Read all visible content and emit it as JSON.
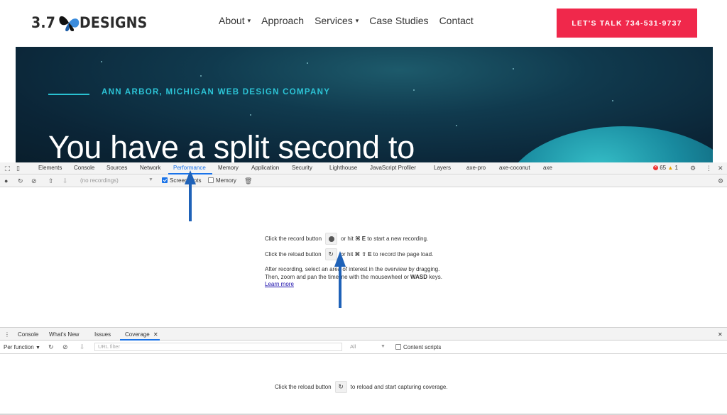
{
  "site": {
    "logo_left": "3.7",
    "logo_right": "DESIGNS",
    "nav": [
      {
        "label": "About",
        "dropdown": true
      },
      {
        "label": "Approach",
        "dropdown": false
      },
      {
        "label": "Services",
        "dropdown": true
      },
      {
        "label": "Case Studies",
        "dropdown": false
      },
      {
        "label": "Contact",
        "dropdown": false
      }
    ],
    "cta_label": "LET'S TALK 734-531-9737",
    "cta_color": "#f0284b"
  },
  "hero": {
    "tagline": "ANN ARBOR, MICHIGAN WEB DESIGN COMPANY",
    "headline": "You have a split second to"
  },
  "devtools": {
    "tabs": [
      "Elements",
      "Console",
      "Sources",
      "Network",
      "Performance",
      "Memory",
      "Application",
      "Security",
      "Lighthouse",
      "JavaScript Profiler",
      "Layers",
      "axe-pro",
      "axe-coconut",
      "axe"
    ],
    "active_tab": "Performance",
    "error_count": "65",
    "warning_count": "1",
    "recordings_placeholder": "(no recordings)",
    "screenshots_label": "Screenshots",
    "screenshots_checked": true,
    "memory_label": "Memory",
    "memory_checked": false,
    "record_line_pre": "Click the record button",
    "record_line_mid": "or hit",
    "record_shortcut": "⌘ E",
    "record_line_post": "to start a new recording.",
    "reload_line_pre": "Click the reload button",
    "reload_line_mid": "or hit",
    "reload_shortcut": "⌘ ⇧ E",
    "reload_line_post": "to record the page load.",
    "para_line1": "After recording, select an area of interest in the overview by dragging.",
    "para_line2_pre": "Then, zoom and pan the timeline with the mousewheel or",
    "para_line2_bold": "WASD",
    "para_line2_post": "keys.",
    "learn_more": "Learn more"
  },
  "drawer": {
    "tabs": [
      "Console",
      "What's New",
      "Issues",
      "Coverage"
    ],
    "active_tab": "Coverage",
    "per_function": "Per function",
    "url_filter_placeholder": "URL filter",
    "all_select": "All",
    "content_scripts_label": "Content scripts",
    "coverage_pre": "Click the reload button",
    "coverage_post": "to reload and start capturing coverage."
  },
  "colors": {
    "accent_blue": "#1a73e8",
    "hero_tag": "#2cc4d6",
    "annotation_arrow": "#1f62b8"
  }
}
